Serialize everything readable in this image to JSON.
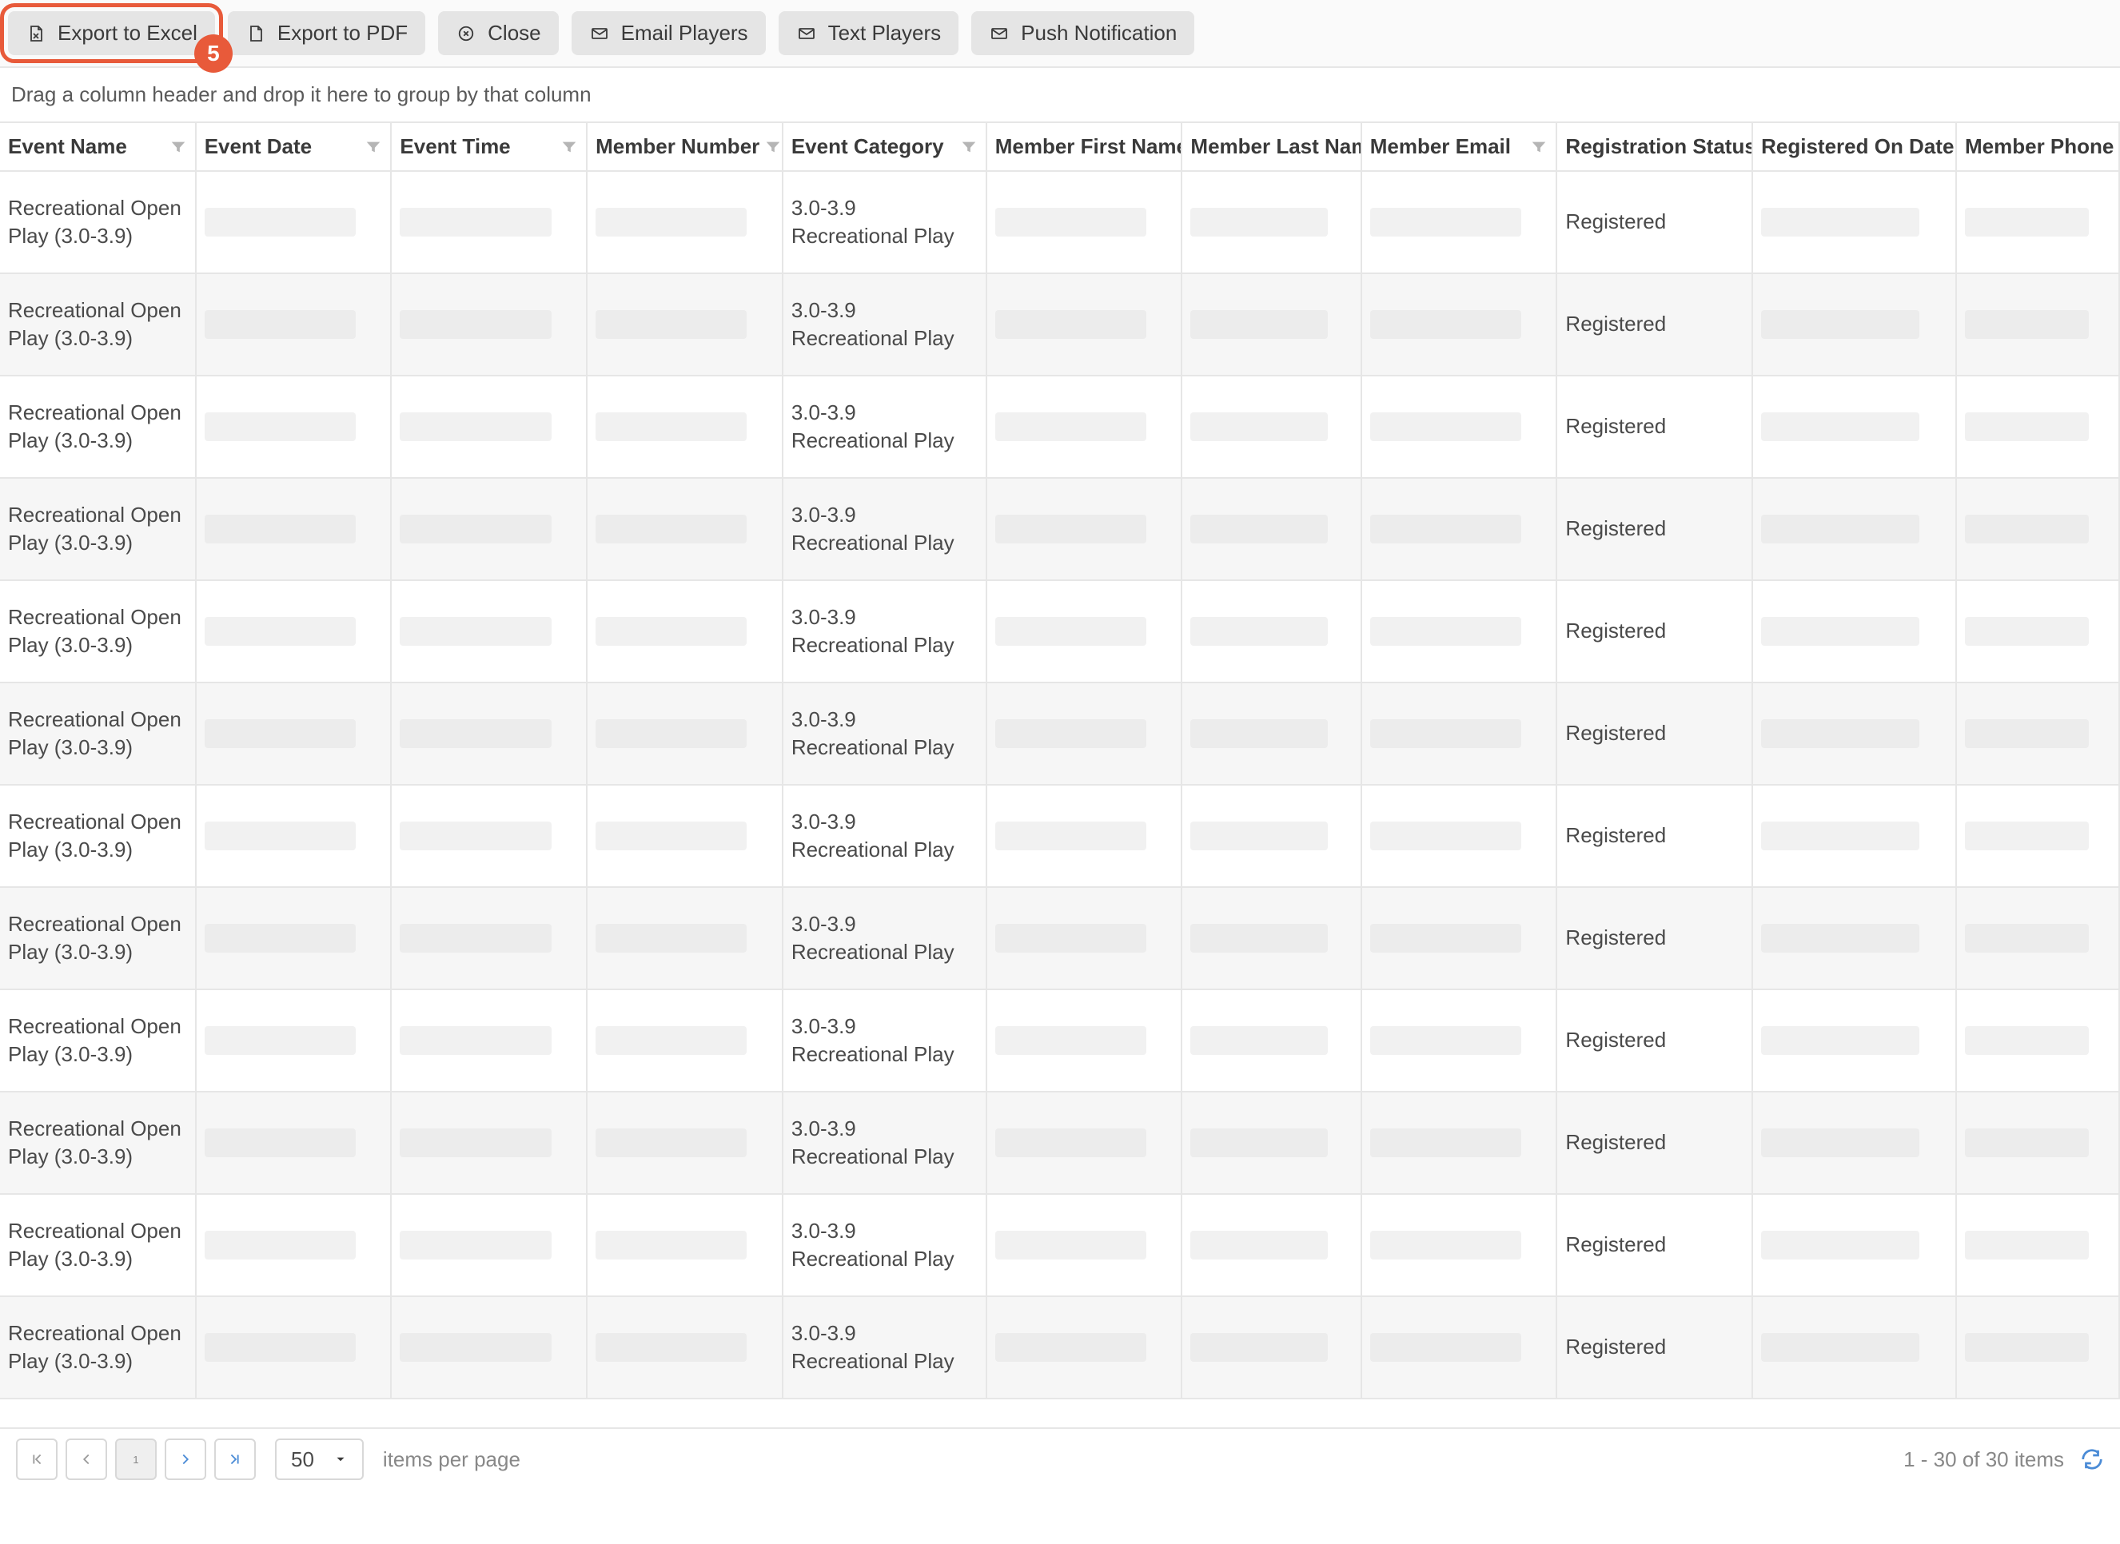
{
  "annotation_badge": "5",
  "toolbar": {
    "export_excel": "Export to Excel",
    "export_pdf": "Export to PDF",
    "close": "Close",
    "email_players": "Email Players",
    "text_players": "Text Players",
    "push_notification": "Push Notification"
  },
  "group_hint": "Drag a column header and drop it here to group by that column",
  "columns": [
    {
      "label": "Event Name"
    },
    {
      "label": "Event Date"
    },
    {
      "label": "Event Time"
    },
    {
      "label": "Member Number"
    },
    {
      "label": "Event Category"
    },
    {
      "label": "Member First Name"
    },
    {
      "label": "Member Last Name"
    },
    {
      "label": "Member Email"
    },
    {
      "label": "Registration Status"
    },
    {
      "label": "Registered On Date..."
    },
    {
      "label": "Member Phone"
    }
  ],
  "row_template": {
    "event_name": "Recreational Open Play (3.0-3.9)",
    "event_category": "3.0-3.9 Recreational Play",
    "registration_status": "Registered"
  },
  "row_count": 12,
  "pager": {
    "page": "1",
    "size": "50",
    "items_per_page": "items per page",
    "summary": "1 - 30 of 30 items"
  }
}
